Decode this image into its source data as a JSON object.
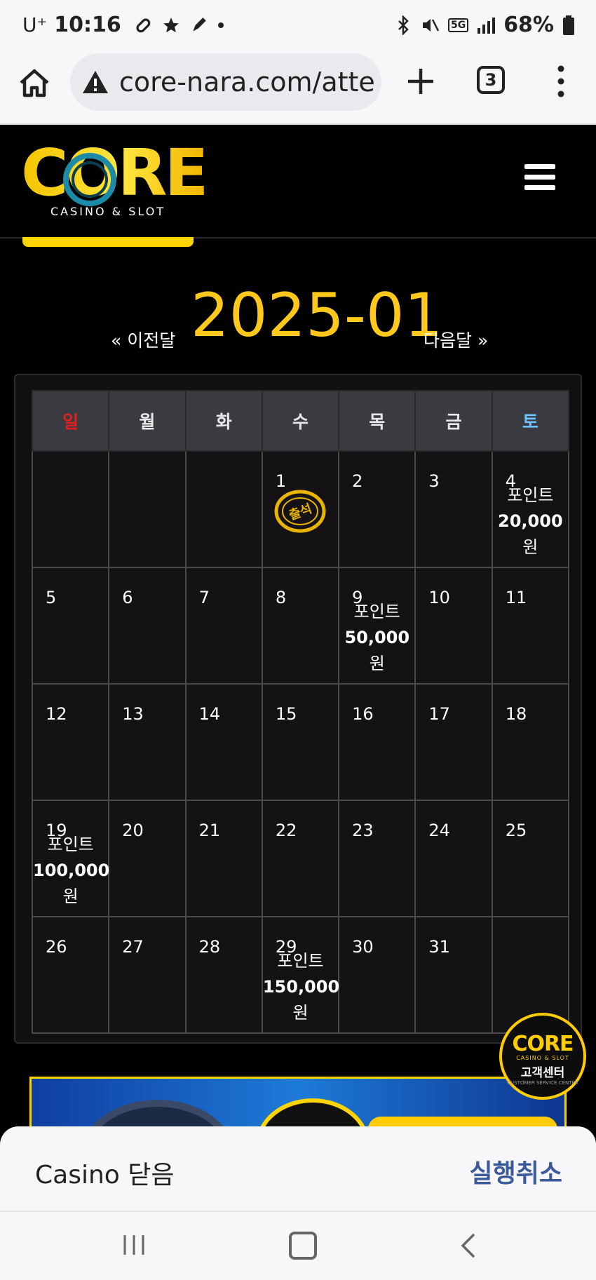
{
  "status_bar": {
    "carrier": "U⁺",
    "time": "10:16",
    "network": "5G",
    "battery": "68%"
  },
  "browser": {
    "url": "core-nara.com/atte",
    "tab_count": "3"
  },
  "site": {
    "logo_word": "CORE",
    "logo_sub": "CASINO & SLOT"
  },
  "calendar": {
    "prev_label": "« 이전달",
    "month": "2025-01",
    "next_label": "다음달 »",
    "weekdays": [
      "일",
      "월",
      "화",
      "수",
      "목",
      "금",
      "토"
    ],
    "weekday_colors": {
      "sun": "#e02020",
      "sat": "#6cc3ff"
    },
    "attendance_stamp": "출석",
    "days": {
      "d1": "1",
      "d2": "2",
      "d3": "3",
      "d4": "4",
      "d5": "5",
      "d6": "6",
      "d7": "7",
      "d8": "8",
      "d9": "9",
      "d10": "10",
      "d11": "11",
      "d12": "12",
      "d13": "13",
      "d14": "14",
      "d15": "15",
      "d16": "16",
      "d17": "17",
      "d18": "18",
      "d19": "19",
      "d20": "20",
      "d21": "21",
      "d22": "22",
      "d23": "23",
      "d24": "24",
      "d25": "25",
      "d26": "26",
      "d27": "27",
      "d28": "28",
      "d29": "29",
      "d30": "30",
      "d31": "31"
    },
    "rewards": {
      "label": "포인트",
      "unit": "원",
      "d4": "20,000",
      "d9": "50,000",
      "d19": "100,000",
      "d29": "150,000"
    }
  },
  "support_badge": {
    "word": "CORE",
    "sub": "CASINO & SLOT",
    "label": "고객센터",
    "tag": "CUSTOMER SERVICE CENTER"
  },
  "snackbar": {
    "message": "Casino 닫음",
    "action": "실행취소"
  },
  "colors": {
    "accent_yellow": "#ffc81a",
    "snackbar_action": "#3c5a9a"
  }
}
